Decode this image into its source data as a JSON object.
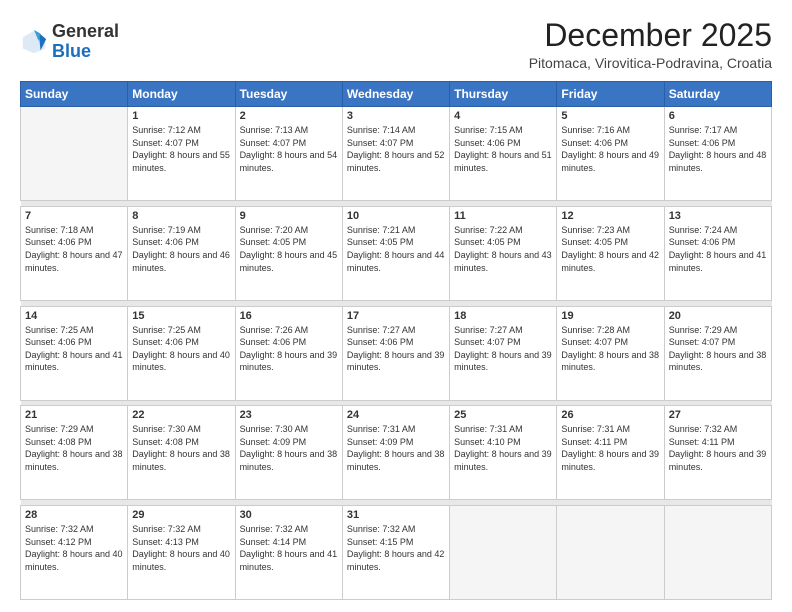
{
  "logo": {
    "general": "General",
    "blue": "Blue"
  },
  "header": {
    "month": "December 2025",
    "location": "Pitomaca, Virovitica-Podravina, Croatia"
  },
  "days_of_week": [
    "Sunday",
    "Monday",
    "Tuesday",
    "Wednesday",
    "Thursday",
    "Friday",
    "Saturday"
  ],
  "weeks": [
    [
      {
        "day": "",
        "sunrise": "",
        "sunset": "",
        "daylight": ""
      },
      {
        "day": "1",
        "sunrise": "7:12 AM",
        "sunset": "4:07 PM",
        "daylight": "8 hours and 55 minutes."
      },
      {
        "day": "2",
        "sunrise": "7:13 AM",
        "sunset": "4:07 PM",
        "daylight": "8 hours and 54 minutes."
      },
      {
        "day": "3",
        "sunrise": "7:14 AM",
        "sunset": "4:07 PM",
        "daylight": "8 hours and 52 minutes."
      },
      {
        "day": "4",
        "sunrise": "7:15 AM",
        "sunset": "4:06 PM",
        "daylight": "8 hours and 51 minutes."
      },
      {
        "day": "5",
        "sunrise": "7:16 AM",
        "sunset": "4:06 PM",
        "daylight": "8 hours and 49 minutes."
      },
      {
        "day": "6",
        "sunrise": "7:17 AM",
        "sunset": "4:06 PM",
        "daylight": "8 hours and 48 minutes."
      }
    ],
    [
      {
        "day": "7",
        "sunrise": "7:18 AM",
        "sunset": "4:06 PM",
        "daylight": "8 hours and 47 minutes."
      },
      {
        "day": "8",
        "sunrise": "7:19 AM",
        "sunset": "4:06 PM",
        "daylight": "8 hours and 46 minutes."
      },
      {
        "day": "9",
        "sunrise": "7:20 AM",
        "sunset": "4:05 PM",
        "daylight": "8 hours and 45 minutes."
      },
      {
        "day": "10",
        "sunrise": "7:21 AM",
        "sunset": "4:05 PM",
        "daylight": "8 hours and 44 minutes."
      },
      {
        "day": "11",
        "sunrise": "7:22 AM",
        "sunset": "4:05 PM",
        "daylight": "8 hours and 43 minutes."
      },
      {
        "day": "12",
        "sunrise": "7:23 AM",
        "sunset": "4:05 PM",
        "daylight": "8 hours and 42 minutes."
      },
      {
        "day": "13",
        "sunrise": "7:24 AM",
        "sunset": "4:06 PM",
        "daylight": "8 hours and 41 minutes."
      }
    ],
    [
      {
        "day": "14",
        "sunrise": "7:25 AM",
        "sunset": "4:06 PM",
        "daylight": "8 hours and 41 minutes."
      },
      {
        "day": "15",
        "sunrise": "7:25 AM",
        "sunset": "4:06 PM",
        "daylight": "8 hours and 40 minutes."
      },
      {
        "day": "16",
        "sunrise": "7:26 AM",
        "sunset": "4:06 PM",
        "daylight": "8 hours and 39 minutes."
      },
      {
        "day": "17",
        "sunrise": "7:27 AM",
        "sunset": "4:06 PM",
        "daylight": "8 hours and 39 minutes."
      },
      {
        "day": "18",
        "sunrise": "7:27 AM",
        "sunset": "4:07 PM",
        "daylight": "8 hours and 39 minutes."
      },
      {
        "day": "19",
        "sunrise": "7:28 AM",
        "sunset": "4:07 PM",
        "daylight": "8 hours and 38 minutes."
      },
      {
        "day": "20",
        "sunrise": "7:29 AM",
        "sunset": "4:07 PM",
        "daylight": "8 hours and 38 minutes."
      }
    ],
    [
      {
        "day": "21",
        "sunrise": "7:29 AM",
        "sunset": "4:08 PM",
        "daylight": "8 hours and 38 minutes."
      },
      {
        "day": "22",
        "sunrise": "7:30 AM",
        "sunset": "4:08 PM",
        "daylight": "8 hours and 38 minutes."
      },
      {
        "day": "23",
        "sunrise": "7:30 AM",
        "sunset": "4:09 PM",
        "daylight": "8 hours and 38 minutes."
      },
      {
        "day": "24",
        "sunrise": "7:31 AM",
        "sunset": "4:09 PM",
        "daylight": "8 hours and 38 minutes."
      },
      {
        "day": "25",
        "sunrise": "7:31 AM",
        "sunset": "4:10 PM",
        "daylight": "8 hours and 39 minutes."
      },
      {
        "day": "26",
        "sunrise": "7:31 AM",
        "sunset": "4:11 PM",
        "daylight": "8 hours and 39 minutes."
      },
      {
        "day": "27",
        "sunrise": "7:32 AM",
        "sunset": "4:11 PM",
        "daylight": "8 hours and 39 minutes."
      }
    ],
    [
      {
        "day": "28",
        "sunrise": "7:32 AM",
        "sunset": "4:12 PM",
        "daylight": "8 hours and 40 minutes."
      },
      {
        "day": "29",
        "sunrise": "7:32 AM",
        "sunset": "4:13 PM",
        "daylight": "8 hours and 40 minutes."
      },
      {
        "day": "30",
        "sunrise": "7:32 AM",
        "sunset": "4:14 PM",
        "daylight": "8 hours and 41 minutes."
      },
      {
        "day": "31",
        "sunrise": "7:32 AM",
        "sunset": "4:15 PM",
        "daylight": "8 hours and 42 minutes."
      },
      {
        "day": "",
        "sunrise": "",
        "sunset": "",
        "daylight": ""
      },
      {
        "day": "",
        "sunrise": "",
        "sunset": "",
        "daylight": ""
      },
      {
        "day": "",
        "sunrise": "",
        "sunset": "",
        "daylight": ""
      }
    ]
  ],
  "labels": {
    "sunrise": "Sunrise:",
    "sunset": "Sunset:",
    "daylight": "Daylight:"
  }
}
